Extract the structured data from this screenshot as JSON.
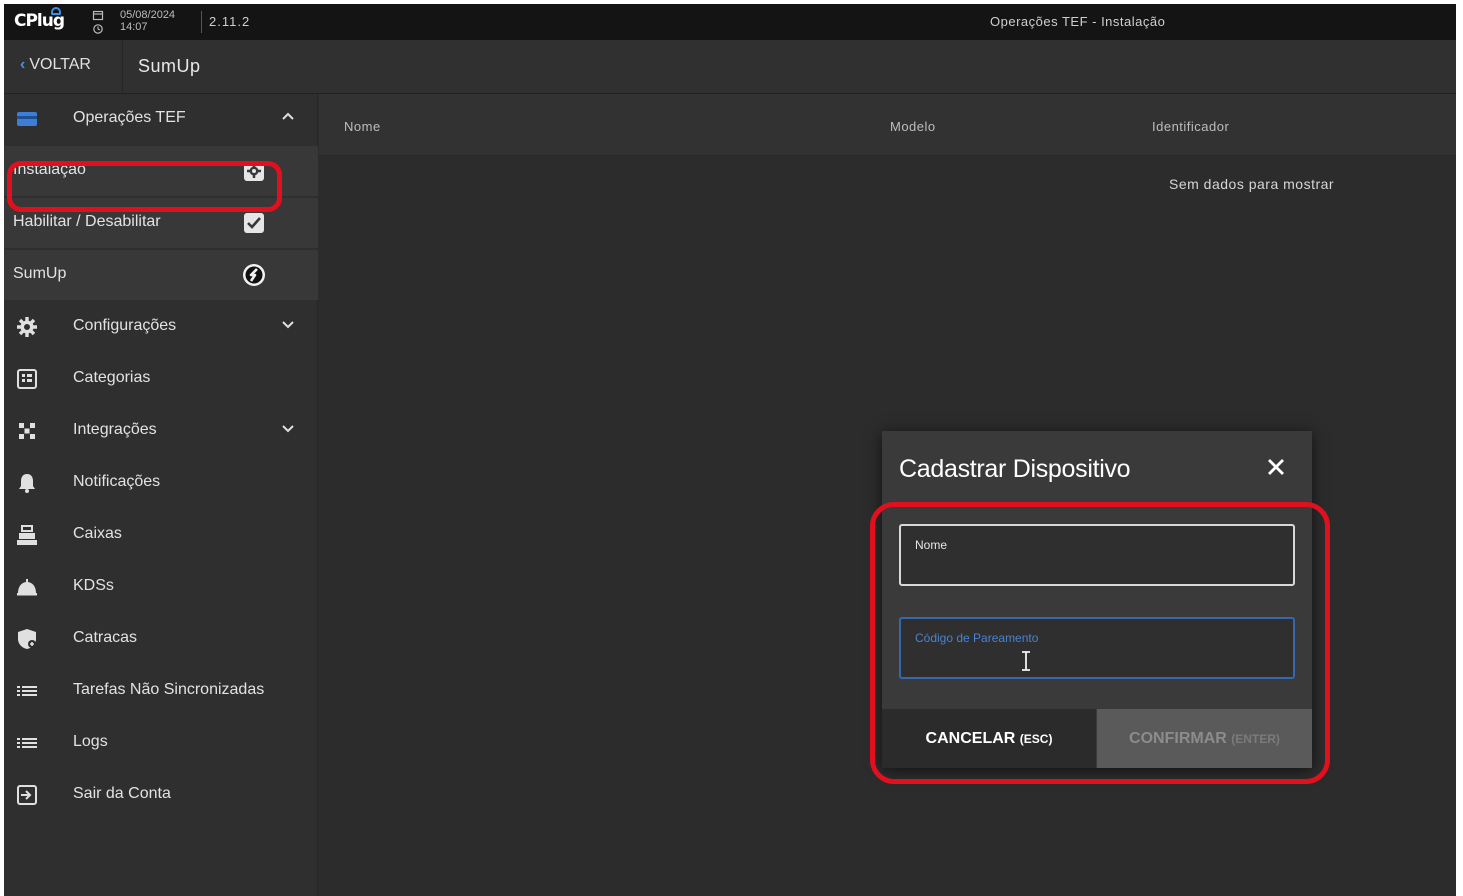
{
  "topbar": {
    "logo": "CPlug",
    "date": "05/08/2024",
    "time": "14:07",
    "version": "2.11.2",
    "title": "Operações TEF - Instalação"
  },
  "navbar": {
    "back_label": "VOLTAR",
    "page_title": "SumUp"
  },
  "sidebar": {
    "section": {
      "label": "Operações TEF",
      "icon": "credit-card-icon",
      "expanded": true
    },
    "subitems": [
      {
        "label": "Instalação",
        "icon": "gear-box-icon"
      },
      {
        "label": "Habilitar / Desabilitar",
        "icon": "checkbox-icon"
      },
      {
        "label": "SumUp",
        "icon": "sumup-logo-icon",
        "active": true
      }
    ],
    "items": [
      {
        "label": "Configurações",
        "icon": "gear-icon",
        "expandable": true
      },
      {
        "label": "Categorias",
        "icon": "grid-icon"
      },
      {
        "label": "Integrações",
        "icon": "integration-icon",
        "expandable": true
      },
      {
        "label": "Notificações",
        "icon": "bell-icon"
      },
      {
        "label": "Caixas",
        "icon": "cash-register-icon"
      },
      {
        "label": "KDSs",
        "icon": "kitchen-bell-icon"
      },
      {
        "label": "Catracas",
        "icon": "turnstile-icon"
      },
      {
        "label": "Tarefas Não Sincronizadas",
        "icon": "list-icon"
      },
      {
        "label": "Logs",
        "icon": "list-icon"
      },
      {
        "label": "Sair da Conta",
        "icon": "logout-icon"
      }
    ]
  },
  "table": {
    "columns": [
      "Nome",
      "Modelo",
      "Identificador"
    ],
    "empty_message": "Sem dados para mostrar"
  },
  "modal": {
    "title": "Cadastrar Dispositivo",
    "fields": [
      {
        "label": "Nome",
        "value": ""
      },
      {
        "label": "Código de Pareamento",
        "value": ""
      }
    ],
    "cancel_label": "CANCELAR",
    "cancel_hint": "(ESC)",
    "confirm_label": "CONFIRMAR",
    "confirm_hint": "(ENTER)"
  },
  "colors": {
    "highlight": "#e0101e",
    "accent": "#4a90e2",
    "background": "#2c2c2c"
  }
}
